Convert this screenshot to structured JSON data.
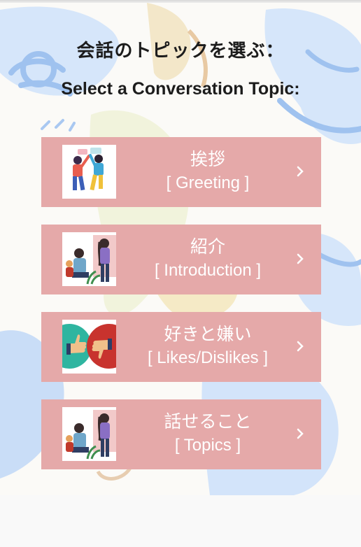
{
  "header": {
    "title_jp": "会話のトピックを選ぶ：",
    "title_en": "Select a Conversation Topic:"
  },
  "topics": [
    {
      "label_jp": "挨拶",
      "label_en": "[ Greeting ]",
      "icon": "people-high-five-illustration"
    },
    {
      "label_jp": "紹介",
      "label_en": "[ Introduction ]",
      "icon": "people-meeting-illustration"
    },
    {
      "label_jp": "好きと嫌い",
      "label_en": "[ Likes/Dislikes ]",
      "icon": "thumbs-up-down-icon"
    },
    {
      "label_jp": "話せること",
      "label_en": "[ Topics ]",
      "icon": "people-meeting-illustration"
    }
  ],
  "colors": {
    "button_bg": "#e5a9a9",
    "text_white": "#ffffff",
    "title_text": "#1c1c1c",
    "background_art_blue": "#b9d3f3"
  }
}
